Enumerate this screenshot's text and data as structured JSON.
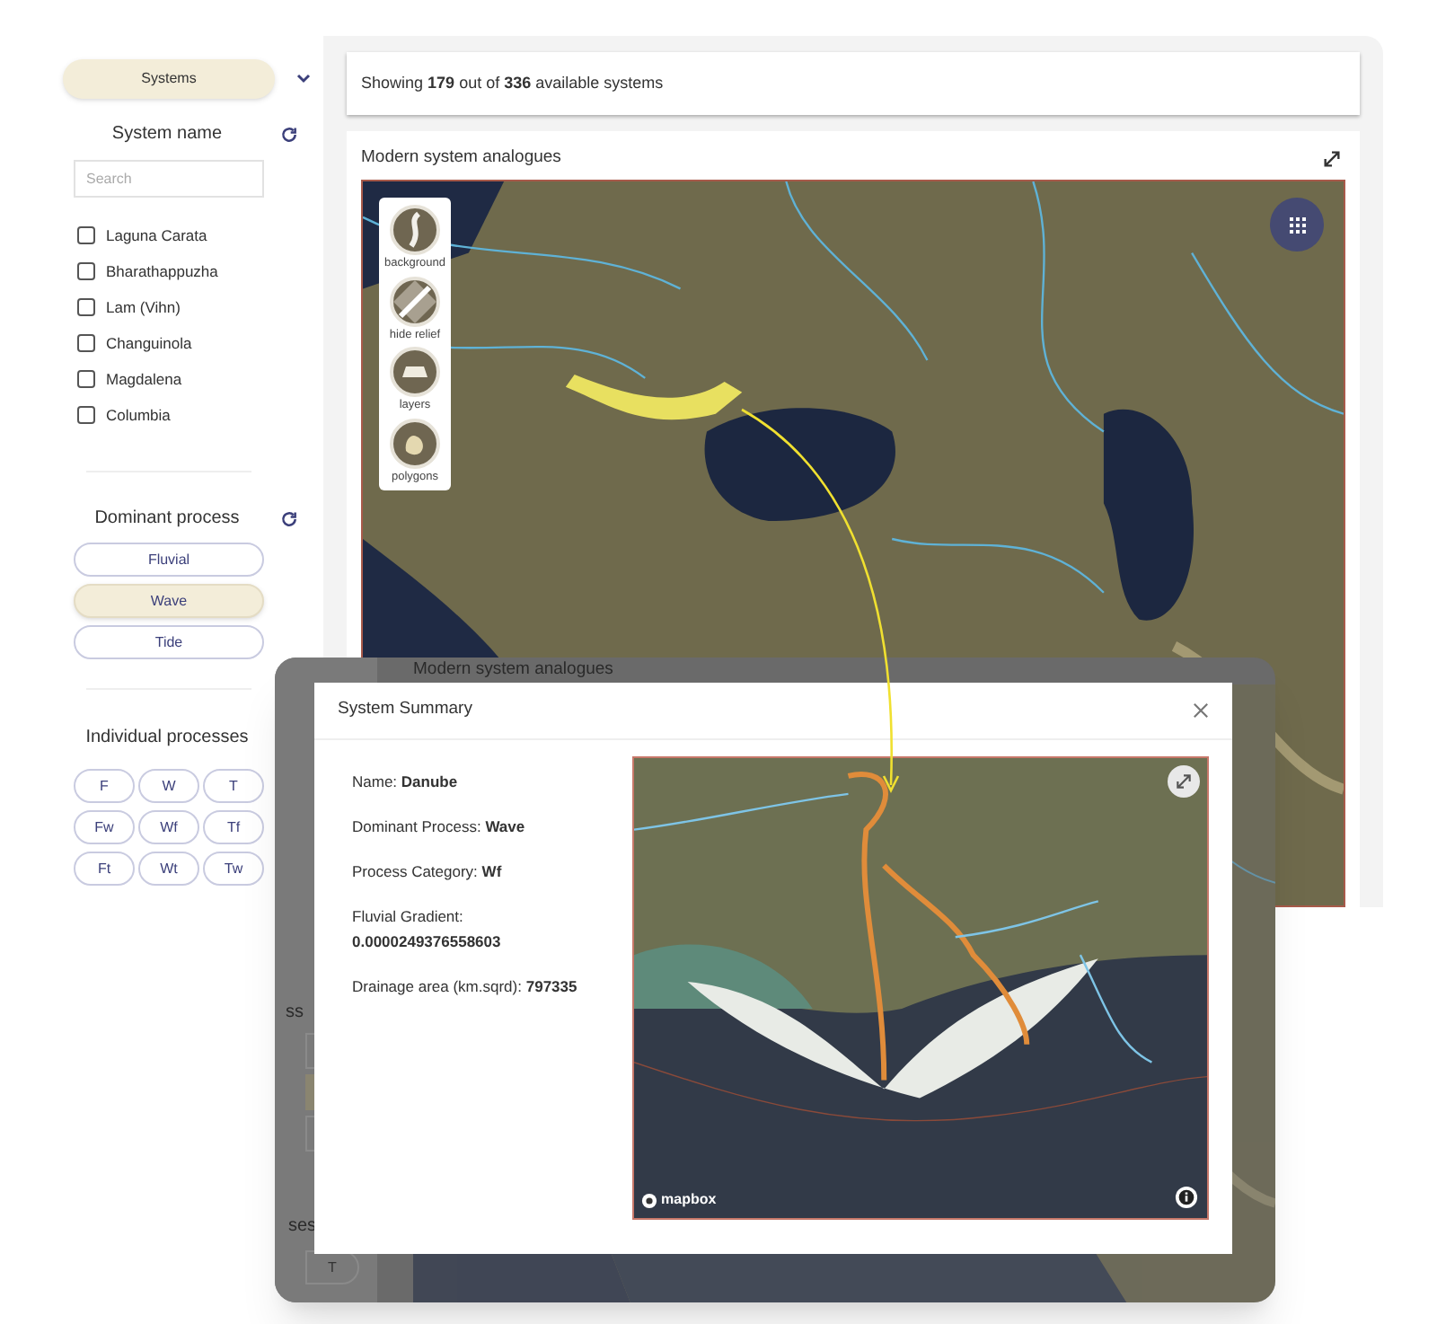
{
  "sidebar": {
    "systems_button": "Systems",
    "system_name": {
      "title": "System name",
      "search_placeholder": "Search",
      "items": [
        {
          "label": "Laguna Carata",
          "checked": false
        },
        {
          "label": "Bharathappuzha",
          "checked": false
        },
        {
          "label": "Lam (Vihn)",
          "checked": false
        },
        {
          "label": "Changuinola",
          "checked": false
        },
        {
          "label": "Magdalena",
          "checked": false
        },
        {
          "label": "Columbia",
          "checked": false
        }
      ]
    },
    "dominant_process": {
      "title": "Dominant process",
      "options": [
        {
          "label": "Fluvial",
          "selected": false
        },
        {
          "label": "Wave",
          "selected": true
        },
        {
          "label": "Tide",
          "selected": false
        }
      ]
    },
    "individual_processes": {
      "title": "Individual processes",
      "options": [
        {
          "label": "F",
          "selected": false
        },
        {
          "label": "W",
          "selected": false
        },
        {
          "label": "T",
          "selected": false
        },
        {
          "label": "Fw",
          "selected": false
        },
        {
          "label": "Wf",
          "selected": false
        },
        {
          "label": "Tf",
          "selected": false
        },
        {
          "label": "Ft",
          "selected": false
        },
        {
          "label": "Wt",
          "selected": false
        },
        {
          "label": "Tw",
          "selected": false
        }
      ]
    }
  },
  "summary_bar": "Showing **179** out of **336** available systems",
  "map_card": {
    "title": "Modern system analogues",
    "layer_controls": [
      {
        "label": "background",
        "kind": "background"
      },
      {
        "label": "hide relief",
        "kind": "relief"
      },
      {
        "label": "layers",
        "kind": "layers"
      },
      {
        "label": "polygons",
        "kind": "polygons"
      }
    ]
  },
  "popup": {
    "background": {
      "map_title": "Modern system analogues",
      "fragment_1": "ss",
      "fragment_2": "ses",
      "button_label": "T"
    },
    "modal": {
      "title": "System Summary",
      "fields": [
        {
          "label": "Name:",
          "value": "Danube",
          "kind": "inline"
        },
        {
          "label": "Dominant Process:",
          "value": "Wave",
          "kind": "inline"
        },
        {
          "label": "Process Category:",
          "value": "Wf",
          "kind": "inline"
        },
        {
          "label": "Fluvial Gradient:",
          "value": "0.0000249376558603",
          "kind": "block"
        },
        {
          "label": "Drainage area (km.sqrd):",
          "value": "797335",
          "kind": "inline"
        }
      ],
      "map_attribution": "mapbox"
    }
  }
}
